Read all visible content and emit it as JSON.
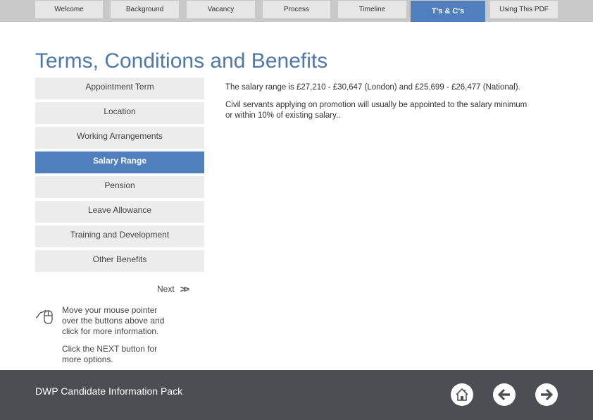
{
  "nav": {
    "tabs": [
      {
        "label": "Welcome",
        "active": false
      },
      {
        "label": "Background",
        "active": false
      },
      {
        "label": "Vacancy",
        "active": false
      },
      {
        "label": "Process",
        "active": false
      },
      {
        "label": "Timeline",
        "active": false
      },
      {
        "label": "T's & C's",
        "active": true
      },
      {
        "label": "Using This PDF",
        "active": false
      }
    ]
  },
  "page": {
    "title": "Terms, Conditions and Benefits"
  },
  "menu": {
    "items": [
      {
        "label": "Appointment Term",
        "active": false
      },
      {
        "label": "Location",
        "active": false
      },
      {
        "label": "Working Arrangements",
        "active": false
      },
      {
        "label": "Salary Range",
        "active": true
      },
      {
        "label": "Pension",
        "active": false
      },
      {
        "label": "Leave Allowance",
        "active": false
      },
      {
        "label": "Training and Development",
        "active": false
      },
      {
        "label": "Other Benefits",
        "active": false
      }
    ]
  },
  "content": {
    "paragraphs": [
      "The salary range is £27,210 - £30,647 (London) and £25,699 - £26,477 (National).",
      "Civil servants applying on promotion will usually be appointed to the salary minimum or within 10% of existing salary.."
    ]
  },
  "next": {
    "label": "Next",
    "icon": "double-chevron-right-icon"
  },
  "help": {
    "icon": "mouse-icon",
    "line1": "Move your mouse pointer over the buttons above and click for more information.",
    "line2": "Click the NEXT button for more options."
  },
  "footer": {
    "title": "DWP Candidate Information Pack",
    "buttons": [
      {
        "name": "home",
        "icon": "home-icon"
      },
      {
        "name": "back",
        "icon": "arrow-left-icon"
      },
      {
        "name": "forward",
        "icon": "arrow-right-icon"
      }
    ]
  },
  "colors": {
    "accent": "#4f80bd",
    "title": "#4f79a8",
    "tab_bg": "#e6e6e6",
    "tabbar_bg": "#c8c8c8",
    "menu_bg": "#ececec",
    "footer_bg": "#4d4e53"
  }
}
